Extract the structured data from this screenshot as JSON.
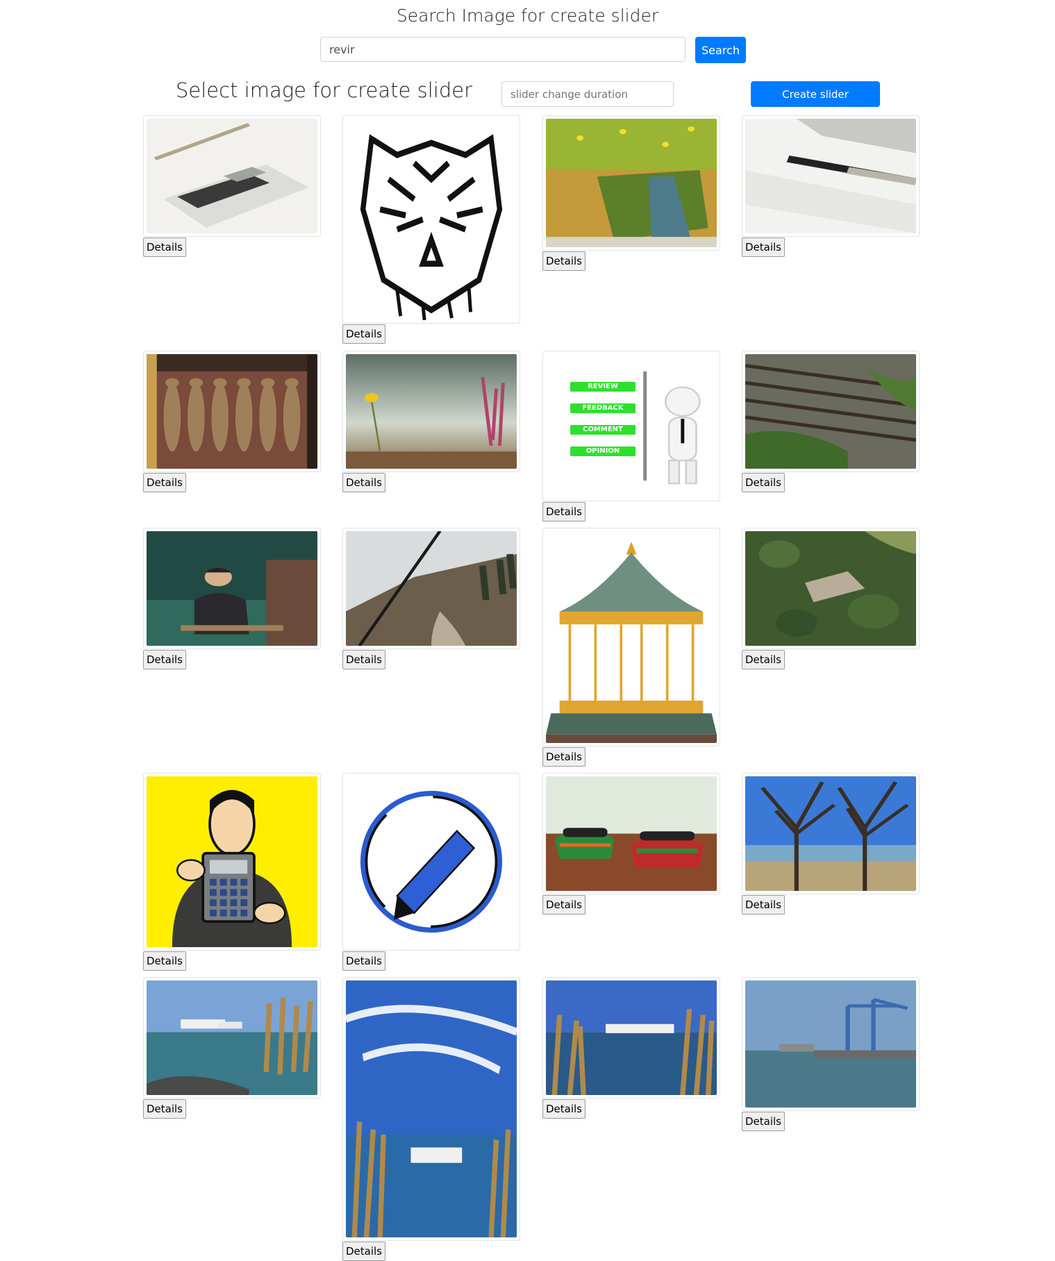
{
  "header": {
    "title": "Search Image for create slider",
    "search_value": "revir",
    "search_label": "Search"
  },
  "toolbar": {
    "section_title": "Select image for create slider",
    "duration_placeholder": "slider change duration",
    "create_label": "Create slider"
  },
  "gallery": {
    "details_label": "Details",
    "items": [
      {
        "subject": "calculator and pen on paper"
      },
      {
        "subject": "tiger face ink drawing"
      },
      {
        "subject": "book in dandelion meadow"
      },
      {
        "subject": "calculator, ruler and fountain pen"
      },
      {
        "subject": "bronze figures sculpture"
      },
      {
        "subject": "yellow flower on hillside"
      },
      {
        "subject": "3d man with review feedback comment opinion signpost"
      },
      {
        "subject": "railway tracks"
      },
      {
        "subject": "young man in classroom"
      },
      {
        "subject": "foggy forest road through windshield"
      },
      {
        "subject": "carousel illustration"
      },
      {
        "subject": "castle ruins in forest aerial"
      },
      {
        "subject": "businessman holding calculator"
      },
      {
        "subject": "pencil icon in circle"
      },
      {
        "subject": "colorful brushes on table"
      },
      {
        "subject": "bare trees by lake"
      },
      {
        "subject": "ferries and reeds on lake"
      },
      {
        "subject": "ferry, reeds and blue sky"
      },
      {
        "subject": "ferry behind reeds"
      },
      {
        "subject": "harbor cranes"
      }
    ]
  },
  "sign_labels": [
    "REVIEW",
    "FEEDBACK",
    "COMMENT",
    "OPINION"
  ]
}
